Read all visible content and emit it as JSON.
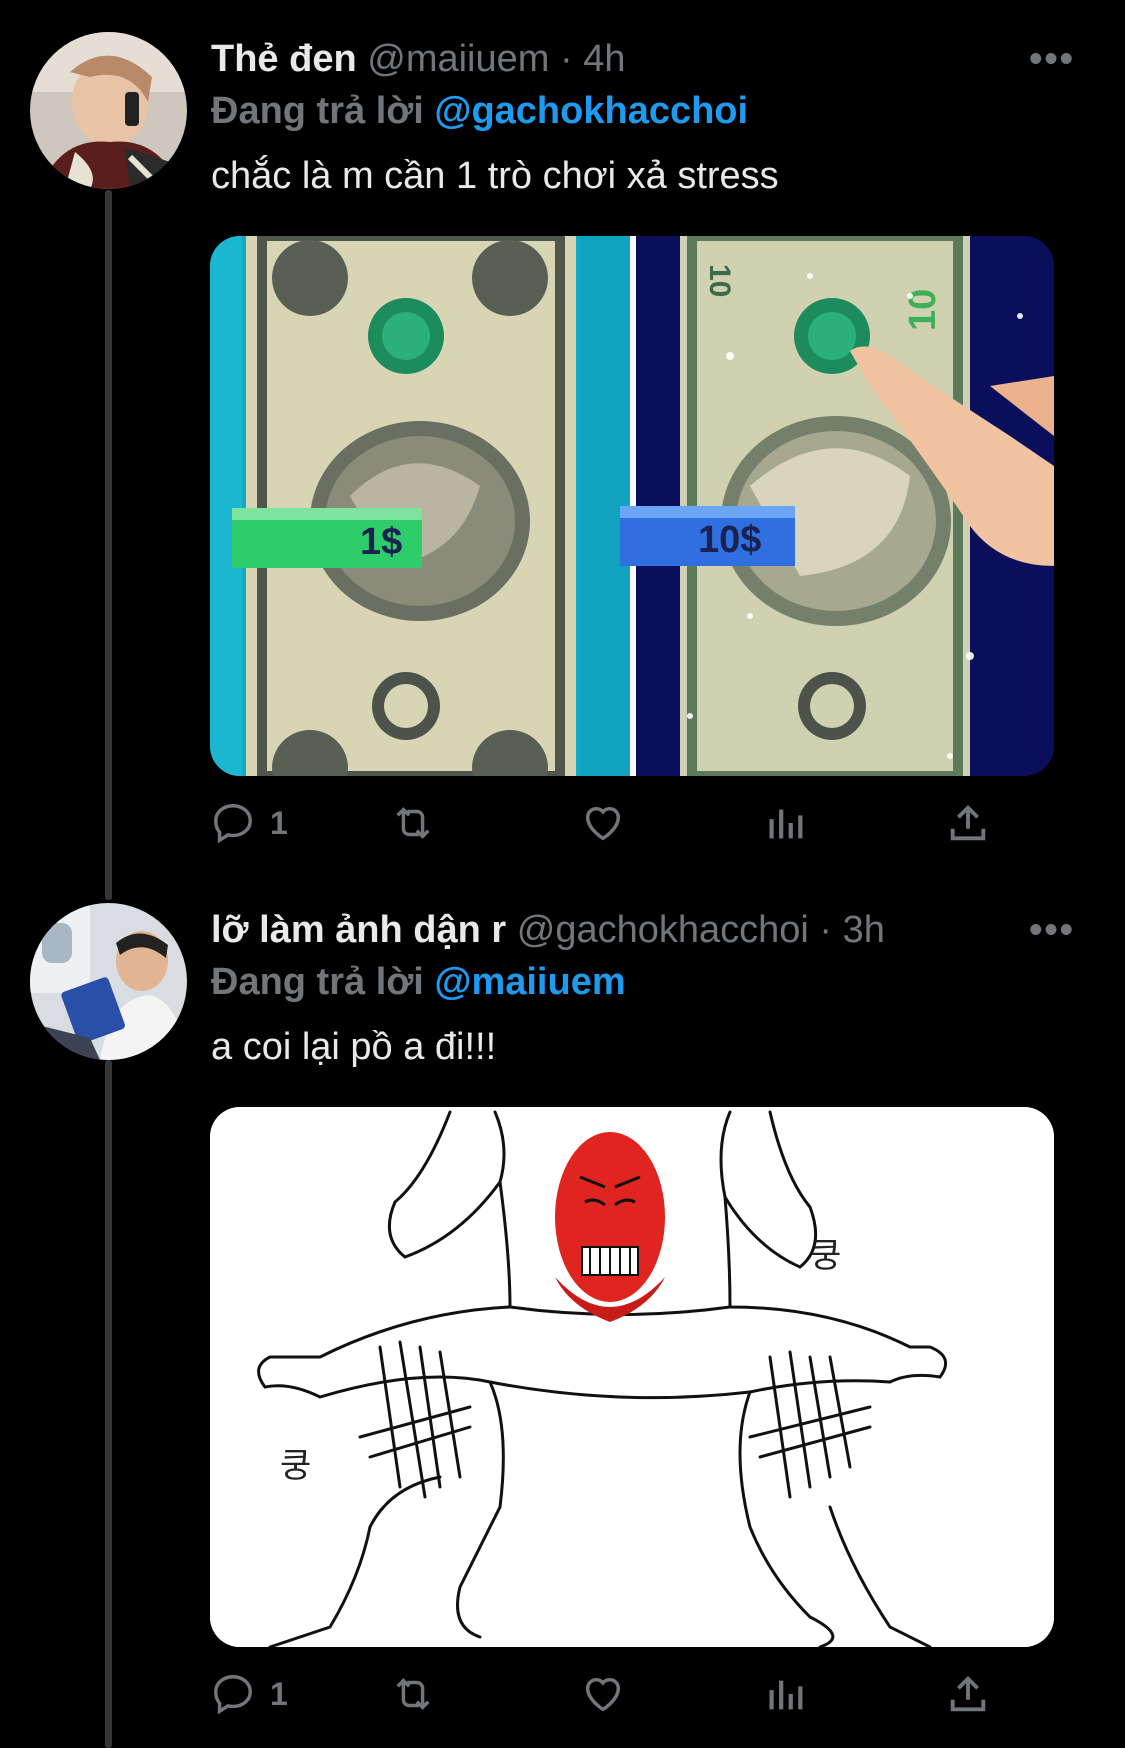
{
  "colors": {
    "background": "#000000",
    "text": "#e7e9ea",
    "muted": "#71767b",
    "link": "#1d9bf0"
  },
  "tweets": [
    {
      "name": "Thẻ đen",
      "handle": "@maiiuem",
      "time": "· 4h",
      "more": "•••",
      "replying_label": "Đang trả lời",
      "replying_to": "@gachokhacchoi",
      "text": "chắc là m cần 1 trò chơi xả stress",
      "media": {
        "left_price": "1$",
        "right_price": "10$",
        "bill_digit": "1",
        "bill_digit_10": "10"
      },
      "actions": {
        "reply_count": "1",
        "icons": [
          "reply-icon",
          "retweet-icon",
          "like-icon",
          "analytics-icon",
          "share-icon"
        ]
      }
    },
    {
      "name": "lỡ làm ảnh dận r",
      "handle": "@gachokhacchoi",
      "time": "· 3h",
      "more": "•••",
      "replying_label": "Đang trả lời",
      "replying_to": "@maiiuem",
      "text": "a coi lại pồ a đi!!!",
      "media": {
        "sfx_top": "쿵",
        "sfx_left": "쿵"
      },
      "actions": {
        "reply_count": "1",
        "icons": [
          "reply-icon",
          "retweet-icon",
          "like-icon",
          "analytics-icon",
          "share-icon"
        ]
      }
    }
  ]
}
